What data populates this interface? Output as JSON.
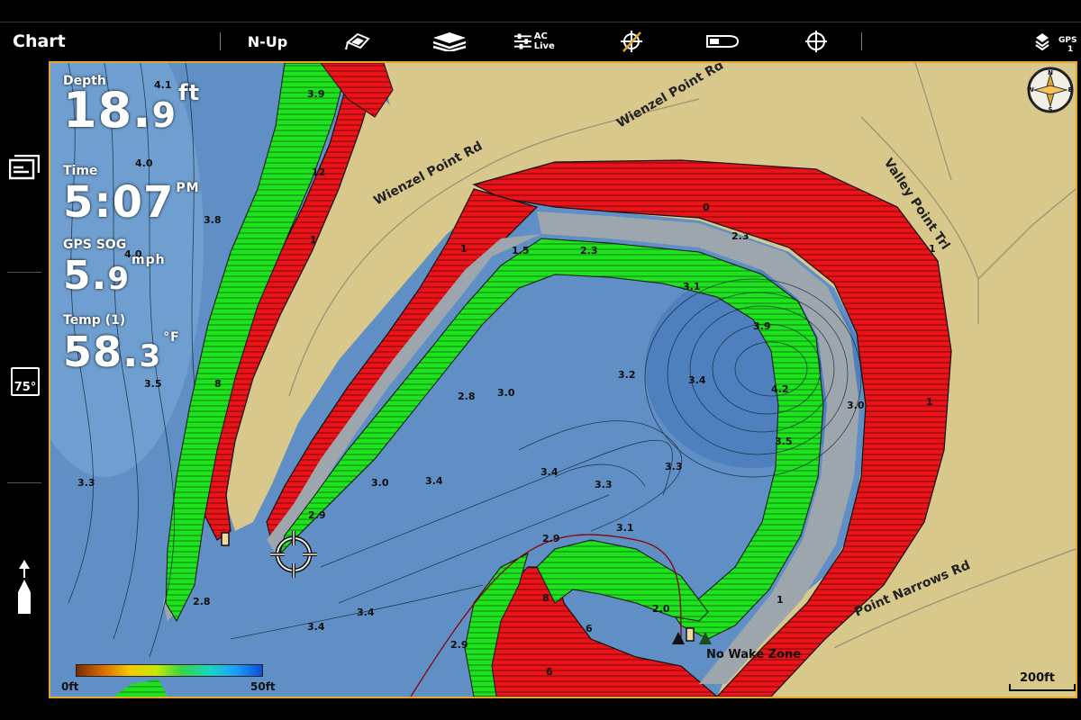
{
  "app": {
    "title": "Chart"
  },
  "toolbar": {
    "orientation": "N-Up",
    "aclive": "AC Live",
    "gps": "GPS",
    "gps_count": "1"
  },
  "readouts": {
    "depth_label": "Depth",
    "depth_value": "18.",
    "depth_decimal": "9",
    "depth_unit": "ft",
    "time_label": "Time",
    "time_value": "5:07",
    "time_suffix": "PM",
    "sog_label": "GPS SOG",
    "sog_value": "5.",
    "sog_decimal": "9",
    "sog_unit": "mph",
    "temp_label": "Temp (1)",
    "temp_value": "58.",
    "temp_decimal": "3",
    "temp_unit": "°F"
  },
  "sidebar": {
    "temp_badge": "75°"
  },
  "roads": [
    "Wienzel Point Rd",
    "Wienzel Point Rd",
    "Valley Point Trl",
    "Point Narrows Rd"
  ],
  "depth_labels": [
    "4.1",
    "3.9",
    "4.0",
    "3.8",
    "4.0",
    "3.5",
    "3.3",
    "2.8",
    "3.4",
    "3.4",
    "2.9",
    "8",
    "1",
    "1",
    "1",
    "12",
    "1.5",
    "2.3",
    "2.3",
    "3.1",
    "3.9",
    "4.2",
    "3.2",
    "3.4",
    "2.8",
    "3.0",
    "3.0",
    "3.4",
    "3.4",
    "3.3",
    "3.3",
    "3.5",
    "3.1",
    "3.0",
    "2.9",
    "8",
    "6",
    "2.0",
    "6",
    "1",
    "1",
    "2.9",
    "0"
  ],
  "legend": {
    "min": "0ft",
    "max": "50ft"
  },
  "scale": {
    "label": "200ft"
  },
  "marker": {
    "label": "No Wake Zone"
  },
  "compass": {
    "n": "N",
    "s": "S",
    "e": "E",
    "w": "W"
  },
  "colors": {
    "land": "#d8c88c",
    "water": "#5f8fc4",
    "shallow_red": "#e8141a",
    "green": "#1ee21e",
    "frame": "#e7a62b"
  }
}
